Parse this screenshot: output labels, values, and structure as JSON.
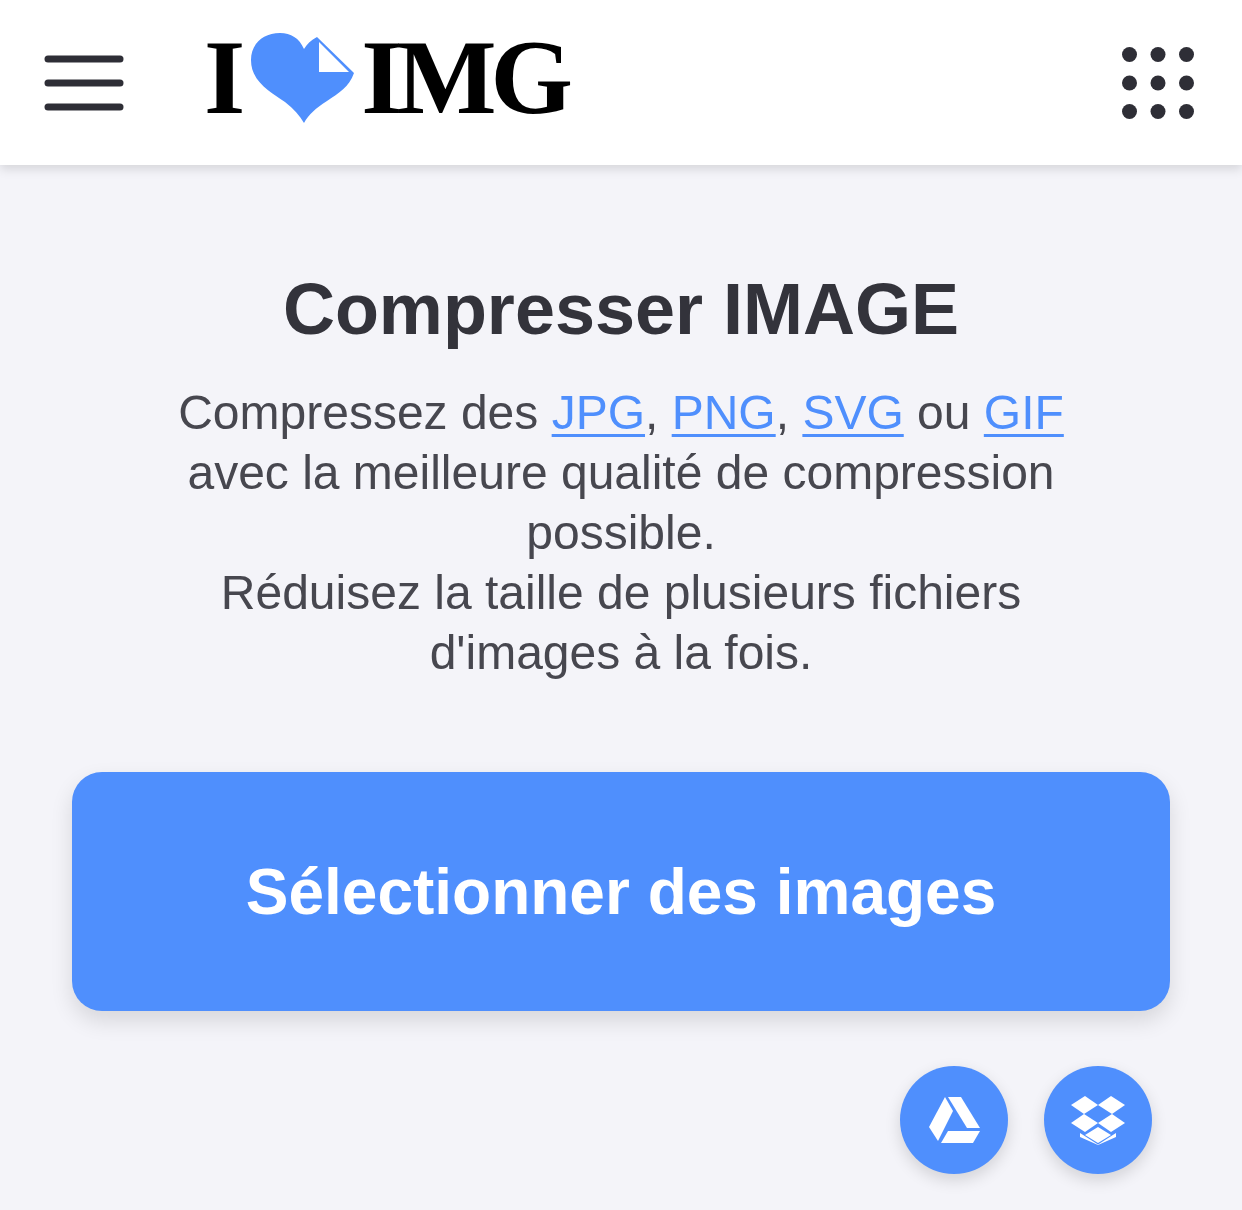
{
  "header": {
    "logo": {
      "before": "I",
      "after": "IMG"
    }
  },
  "hero": {
    "title": "Compresser IMAGE",
    "description": [
      [
        {
          "kind": "text",
          "text": "Compressez des "
        },
        {
          "kind": "link",
          "text": "JPG"
        },
        {
          "kind": "text",
          "text": ", "
        },
        {
          "kind": "link",
          "text": "PNG"
        },
        {
          "kind": "text",
          "text": ", "
        },
        {
          "kind": "link",
          "text": "SVG"
        },
        {
          "kind": "text",
          "text": " ou "
        },
        {
          "kind": "link",
          "text": "GIF"
        },
        {
          "kind": "text",
          "text": " avec la meilleure qualité de compression possible."
        }
      ],
      [
        {
          "kind": "text",
          "text": "Réduisez la taille de plusieurs fichiers d'images à la fois."
        }
      ]
    ]
  },
  "select_button": {
    "label": "Sélectionner des images"
  },
  "cloud_buttons": [
    {
      "kind": "drive"
    },
    {
      "kind": "dropbox"
    }
  ]
}
